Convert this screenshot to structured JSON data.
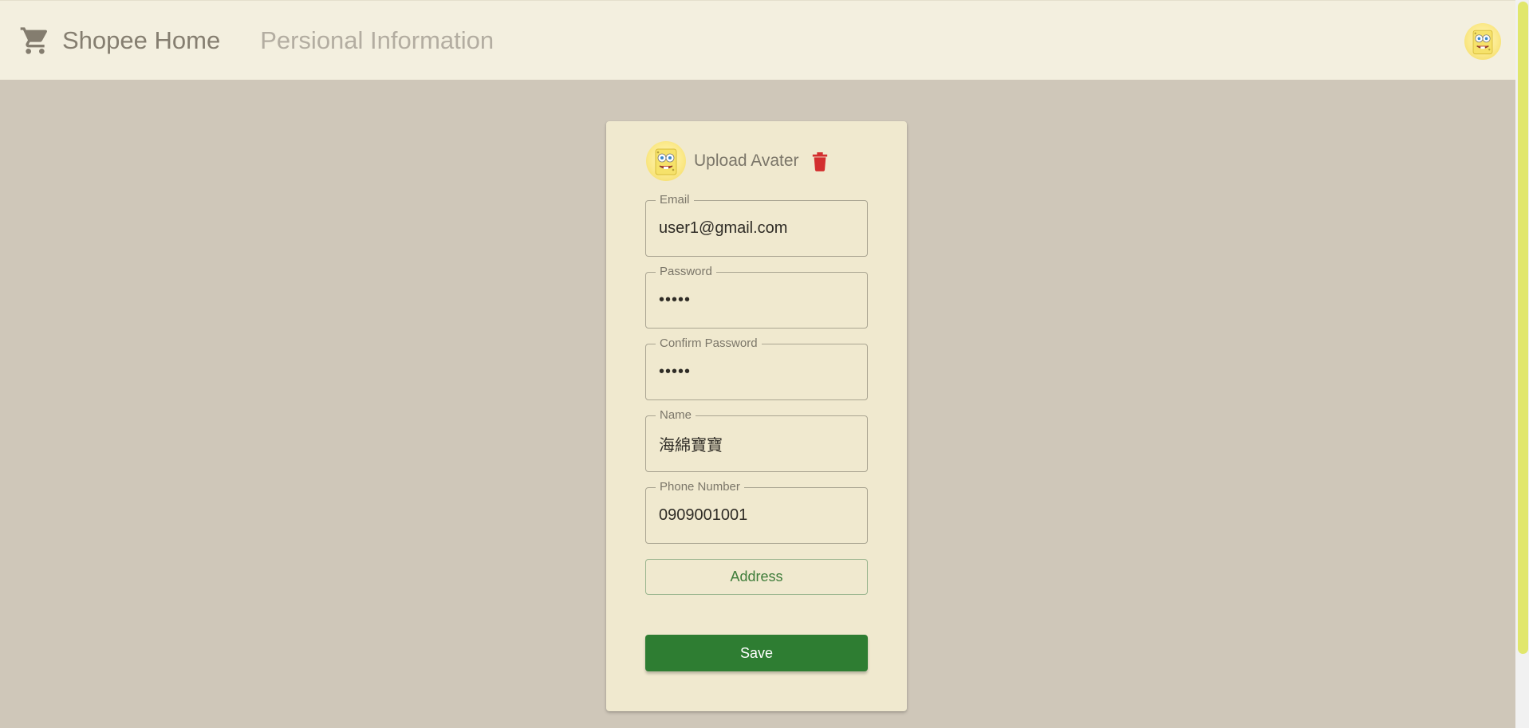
{
  "appbar": {
    "brand_icon": "shopping-cart-icon",
    "brand_label": "Shopee Home",
    "nav_label": "Persional Information",
    "avatar_icon": "spongebob-avatar"
  },
  "profile_form": {
    "avatar_icon": "spongebob-avatar",
    "upload_label": "Upload Avater",
    "delete_icon": "trash-icon",
    "fields": [
      {
        "label": "Email",
        "value": "user1@gmail.com",
        "type": "text"
      },
      {
        "label": "Password",
        "value": "•••••",
        "type": "password"
      },
      {
        "label": "Confirm Password",
        "value": "•••••",
        "type": "password"
      },
      {
        "label": "Name",
        "value": "海綿寶寶",
        "type": "text"
      },
      {
        "label": "Phone Number",
        "value": "0909001001",
        "type": "text"
      }
    ],
    "address_label": "Address",
    "save_label": "Save"
  },
  "colors": {
    "appbar_bg": "#f3efdf",
    "page_bg": "#cfc7b9",
    "card_bg": "#f0e9cf",
    "accent_green": "#2e7d32",
    "delete_red": "#d32f2f",
    "scrollbar_thumb": "#e1e76c"
  }
}
